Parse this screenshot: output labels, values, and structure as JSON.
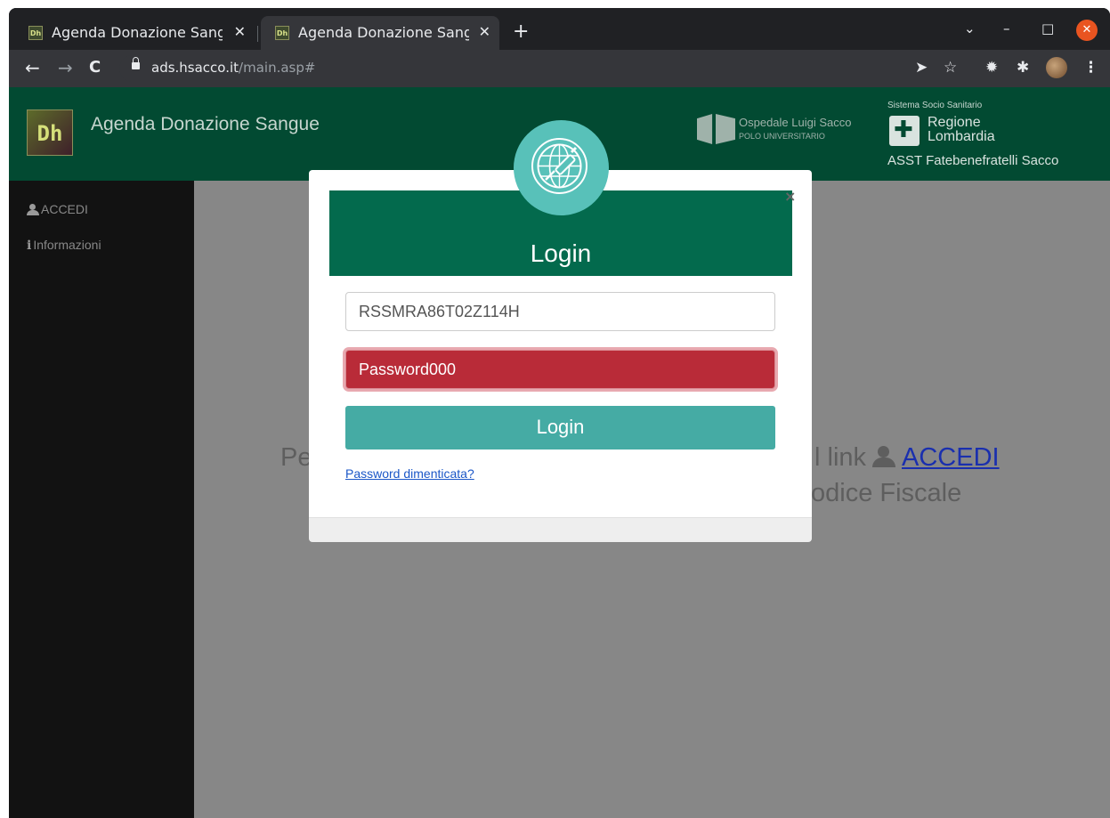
{
  "browser": {
    "tabs": [
      {
        "title": "Agenda Donazione Sangue",
        "favicon": "Dh",
        "active": false
      },
      {
        "title": "Agenda Donazione Sangue",
        "favicon": "Dh",
        "active": true
      }
    ],
    "new_tab": "+",
    "window_controls": {
      "dropdown": "⌄",
      "minimize": "–",
      "maximize": "□",
      "close": "✕"
    },
    "url_host": "ads.hsacco.it",
    "url_path": "/main.asp#"
  },
  "header": {
    "logo_text": "Dh",
    "app_title": "Agenda Donazione Sangue",
    "hospital_name": "Ospedale Luigi Sacco",
    "hospital_sub": "POLO UNIVERSITARIO",
    "region_top": "Sistema Socio Sanitario",
    "region_line1": "Regione",
    "region_line2": "Lombardia",
    "asst": "ASST Fatebenefratelli Sacco"
  },
  "sidebar": {
    "items": [
      {
        "label": "ACCEDI",
        "icon": "user-icon"
      },
      {
        "label": "Informazioni",
        "icon": "info-icon"
      }
    ]
  },
  "background": {
    "line1_start": "Pe",
    "line1_end": "l link",
    "line1_link": "ACCEDI",
    "line2_end": "odice Fiscale"
  },
  "modal": {
    "title": "Login",
    "close": "×",
    "username_value": "RSSMRA86T02Z114H",
    "password_value": "Password000",
    "login_button": "Login",
    "forgot_link": "Password dimenticata?"
  },
  "colors": {
    "header_bg": "#024a32",
    "modal_head": "#036a4d",
    "accent_teal": "#45aba4",
    "error_red": "#b92b38"
  }
}
